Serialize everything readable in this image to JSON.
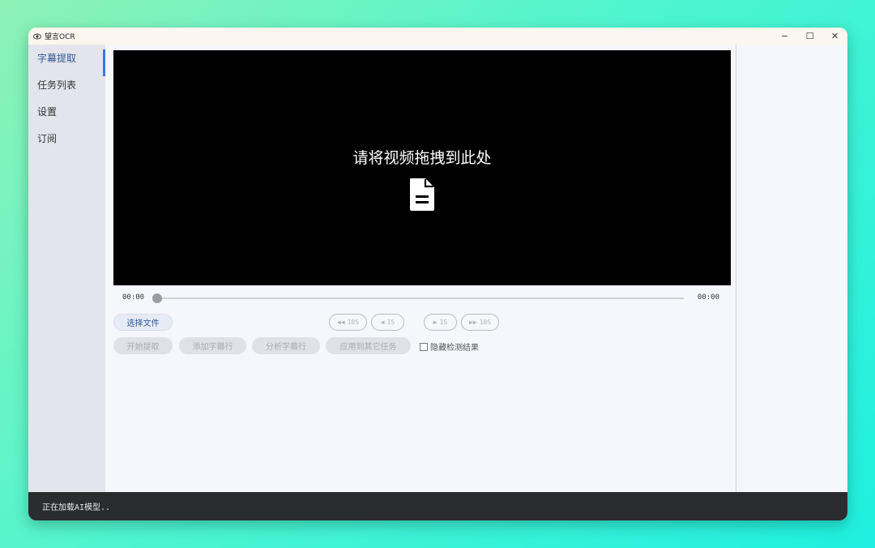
{
  "app": {
    "title": "望言OCR"
  },
  "window_controls": {
    "minimize": "−",
    "maximize": "☐",
    "close": "✕"
  },
  "sidebar": {
    "items": [
      {
        "label": "字幕提取",
        "active": true
      },
      {
        "label": "任务列表",
        "active": false
      },
      {
        "label": "设置",
        "active": false
      },
      {
        "label": "订阅",
        "active": false
      }
    ]
  },
  "video": {
    "drop_hint": "请将视频拖拽到此处",
    "icon": "document-icon"
  },
  "timeline": {
    "current": "00:00",
    "total": "00:00",
    "progress": 0
  },
  "controls": {
    "select_file": "选择文件",
    "back_10s": "10S",
    "back_1s": "1S",
    "fwd_1s": "1S",
    "fwd_10s": "10S"
  },
  "actions": {
    "start": "开始提取",
    "add_line": "添加字幕行",
    "analyze": "分析字幕行",
    "apply": "应用到其它任务",
    "hide_results": "隐藏检测结果",
    "hide_results_checked": false
  },
  "status": {
    "text": "正在加载AI模型.."
  },
  "colors": {
    "accent": "#2f7de1",
    "statusbar": "#2b2c30",
    "video_bg": "#000000"
  }
}
